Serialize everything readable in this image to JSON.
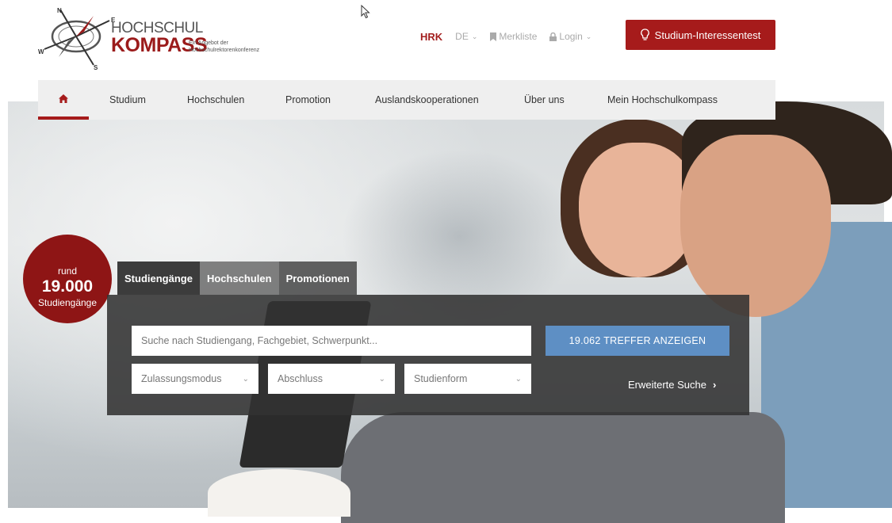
{
  "logo": {
    "line1": "HOCHSCHUL",
    "line2": "KOMPASS",
    "tagline": "Ein Angebot der Hochschulrektorenkonferenz",
    "compass_letters": [
      "N",
      "E",
      "S",
      "W"
    ]
  },
  "topbar": {
    "hrk": "HRK",
    "language": "DE",
    "watchlist": "Merkliste",
    "login": "Login",
    "interest_test": "Studium-Interessentest"
  },
  "nav": {
    "home_icon": "home-icon",
    "items": [
      "Studium",
      "Hochschulen",
      "Promotion",
      "Auslandskooperationen",
      "Über uns",
      "Mein Hochschulkompass"
    ]
  },
  "badge": {
    "prefix": "rund",
    "number": "19.000",
    "label": "Studiengänge"
  },
  "search": {
    "tabs": [
      "Studiengänge",
      "Hochschulen",
      "Promotionen"
    ],
    "placeholder": "Suche nach Studiengang, Fachgebiet, Schwerpunkt...",
    "button": "19.062 TREFFER ANZEIGEN",
    "filters": [
      "Zulassungsmodus",
      "Abschluss",
      "Studienform"
    ],
    "advanced": "Erweiterte Suche"
  },
  "colors": {
    "brand_red": "#a61b1b",
    "button_blue": "#5e8fc4",
    "nav_bg": "#efefef"
  }
}
